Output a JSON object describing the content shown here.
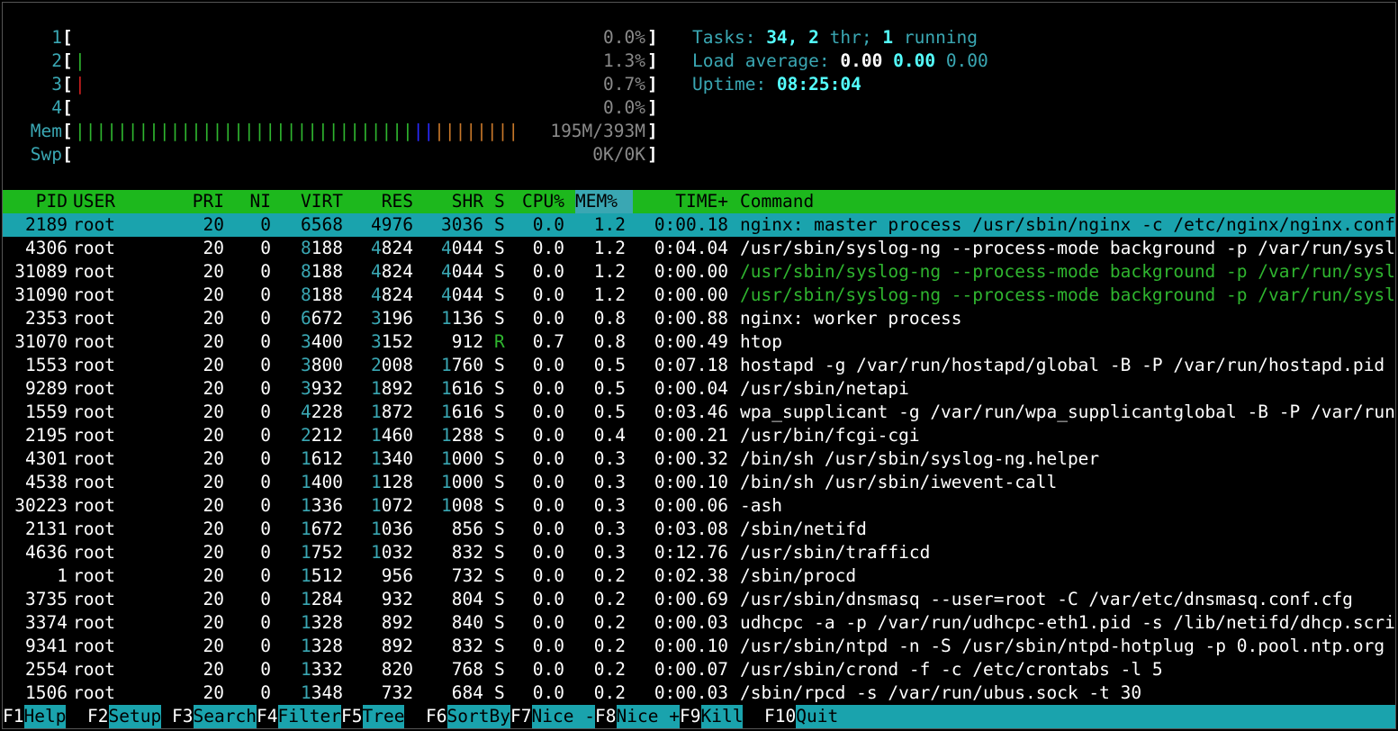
{
  "meters": [
    {
      "label": "1",
      "bars": [],
      "value": "0.0%"
    },
    {
      "label": "2",
      "bars": [
        {
          "color": "green",
          "count": 1
        }
      ],
      "value": "1.3%"
    },
    {
      "label": "3",
      "bars": [
        {
          "color": "red",
          "count": 1
        }
      ],
      "value": "0.7%"
    },
    {
      "label": "4",
      "bars": [],
      "value": "0.0%"
    },
    {
      "label": "Mem",
      "bars": [
        {
          "color": "green",
          "count": 32
        },
        {
          "color": "blue",
          "count": 2
        },
        {
          "color": "orange",
          "count": 8
        }
      ],
      "value": "195M/393M"
    },
    {
      "label": "Swp",
      "bars": [],
      "value": "0K/0K"
    }
  ],
  "summary": {
    "tasks_label": "Tasks: ",
    "tasks_count": "34",
    "tasks_sep": ", ",
    "threads": "2",
    "threads_label": " thr; ",
    "running": "1",
    "running_label": " running",
    "load_label": "Load average: ",
    "load1": "0.00",
    "load5": "0.00",
    "load15": "0.00",
    "uptime_label": "Uptime: ",
    "uptime": "08:25:04"
  },
  "columns": {
    "pid": "PID",
    "user": "USER",
    "pri": "PRI",
    "ni": "NI",
    "virt": "VIRT",
    "res": "RES",
    "shr": "SHR",
    "s": "S",
    "cpu": "CPU%",
    "mem": "MEM%",
    "time": "TIME+",
    "cmd": "Command"
  },
  "processes": [
    {
      "pid": "2189",
      "user": "root",
      "pri": "20",
      "ni": "0",
      "virt": "6568",
      "res": "4976",
      "shr": "3036",
      "s": "S",
      "cpu": "0.0",
      "mem": "1.2",
      "time": "0:00.18",
      "cmd": "nginx: master process /usr/sbin/nginx -c /etc/nginx/nginx.conf",
      "selected": true,
      "thread": false
    },
    {
      "pid": "4306",
      "user": "root",
      "pri": "20",
      "ni": "0",
      "virt": "8188",
      "res": "4824",
      "shr": "4044",
      "s": "S",
      "cpu": "0.0",
      "mem": "1.2",
      "time": "0:04.04",
      "cmd": "/usr/sbin/syslog-ng --process-mode background -p /var/run/syslog-ng.pid",
      "selected": false,
      "thread": false
    },
    {
      "pid": "31089",
      "user": "root",
      "pri": "20",
      "ni": "0",
      "virt": "8188",
      "res": "4824",
      "shr": "4044",
      "s": "S",
      "cpu": "0.0",
      "mem": "1.2",
      "time": "0:00.00",
      "cmd": "/usr/sbin/syslog-ng --process-mode background -p /var/run/syslog-ng.pid",
      "selected": false,
      "thread": true
    },
    {
      "pid": "31090",
      "user": "root",
      "pri": "20",
      "ni": "0",
      "virt": "8188",
      "res": "4824",
      "shr": "4044",
      "s": "S",
      "cpu": "0.0",
      "mem": "1.2",
      "time": "0:00.00",
      "cmd": "/usr/sbin/syslog-ng --process-mode background -p /var/run/syslog-ng.pid",
      "selected": false,
      "thread": true
    },
    {
      "pid": "2353",
      "user": "root",
      "pri": "20",
      "ni": "0",
      "virt": "6672",
      "res": "3196",
      "shr": "1136",
      "s": "S",
      "cpu": "0.0",
      "mem": "0.8",
      "time": "0:00.88",
      "cmd": "nginx: worker process",
      "selected": false,
      "thread": false
    },
    {
      "pid": "31070",
      "user": "root",
      "pri": "20",
      "ni": "0",
      "virt": "3400",
      "res": "3152",
      "shr": "912",
      "s": "R",
      "cpu": "0.7",
      "mem": "0.8",
      "time": "0:00.49",
      "cmd": "htop",
      "selected": false,
      "thread": false
    },
    {
      "pid": "1553",
      "user": "root",
      "pri": "20",
      "ni": "0",
      "virt": "3800",
      "res": "2008",
      "shr": "1760",
      "s": "S",
      "cpu": "0.0",
      "mem": "0.5",
      "time": "0:07.18",
      "cmd": "hostapd -g /var/run/hostapd/global -B -P /var/run/hostapd.pid",
      "selected": false,
      "thread": false
    },
    {
      "pid": "9289",
      "user": "root",
      "pri": "20",
      "ni": "0",
      "virt": "3932",
      "res": "1892",
      "shr": "1616",
      "s": "S",
      "cpu": "0.0",
      "mem": "0.5",
      "time": "0:00.04",
      "cmd": "/usr/sbin/netapi",
      "selected": false,
      "thread": false
    },
    {
      "pid": "1559",
      "user": "root",
      "pri": "20",
      "ni": "0",
      "virt": "4228",
      "res": "1872",
      "shr": "1616",
      "s": "S",
      "cpu": "0.0",
      "mem": "0.5",
      "time": "0:03.46",
      "cmd": "wpa_supplicant -g /var/run/wpa_supplicantglobal -B -P /var/run/wpa.pid",
      "selected": false,
      "thread": false
    },
    {
      "pid": "2195",
      "user": "root",
      "pri": "20",
      "ni": "0",
      "virt": "2212",
      "res": "1460",
      "shr": "1288",
      "s": "S",
      "cpu": "0.0",
      "mem": "0.4",
      "time": "0:00.21",
      "cmd": "/usr/bin/fcgi-cgi",
      "selected": false,
      "thread": false
    },
    {
      "pid": "4301",
      "user": "root",
      "pri": "20",
      "ni": "0",
      "virt": "1612",
      "res": "1340",
      "shr": "1000",
      "s": "S",
      "cpu": "0.0",
      "mem": "0.3",
      "time": "0:00.32",
      "cmd": "/bin/sh /usr/sbin/syslog-ng.helper",
      "selected": false,
      "thread": false
    },
    {
      "pid": "4538",
      "user": "root",
      "pri": "20",
      "ni": "0",
      "virt": "1400",
      "res": "1128",
      "shr": "1000",
      "s": "S",
      "cpu": "0.0",
      "mem": "0.3",
      "time": "0:00.10",
      "cmd": "/bin/sh /usr/sbin/iwevent-call",
      "selected": false,
      "thread": false
    },
    {
      "pid": "30223",
      "user": "root",
      "pri": "20",
      "ni": "0",
      "virt": "1336",
      "res": "1072",
      "shr": "1008",
      "s": "S",
      "cpu": "0.0",
      "mem": "0.3",
      "time": "0:00.06",
      "cmd": "-ash",
      "selected": false,
      "thread": false
    },
    {
      "pid": "2131",
      "user": "root",
      "pri": "20",
      "ni": "0",
      "virt": "1672",
      "res": "1036",
      "shr": "856",
      "s": "S",
      "cpu": "0.0",
      "mem": "0.3",
      "time": "0:03.08",
      "cmd": "/sbin/netifd",
      "selected": false,
      "thread": false
    },
    {
      "pid": "4636",
      "user": "root",
      "pri": "20",
      "ni": "0",
      "virt": "1752",
      "res": "1032",
      "shr": "832",
      "s": "S",
      "cpu": "0.0",
      "mem": "0.3",
      "time": "0:12.76",
      "cmd": "/usr/sbin/trafficd",
      "selected": false,
      "thread": false
    },
    {
      "pid": "1",
      "user": "root",
      "pri": "20",
      "ni": "0",
      "virt": "1512",
      "res": "956",
      "shr": "732",
      "s": "S",
      "cpu": "0.0",
      "mem": "0.2",
      "time": "0:02.38",
      "cmd": "/sbin/procd",
      "selected": false,
      "thread": false
    },
    {
      "pid": "3735",
      "user": "root",
      "pri": "20",
      "ni": "0",
      "virt": "1284",
      "res": "932",
      "shr": "804",
      "s": "S",
      "cpu": "0.0",
      "mem": "0.2",
      "time": "0:00.69",
      "cmd": "/usr/sbin/dnsmasq --user=root -C /var/etc/dnsmasq.conf.cfg",
      "selected": false,
      "thread": false
    },
    {
      "pid": "3374",
      "user": "root",
      "pri": "20",
      "ni": "0",
      "virt": "1328",
      "res": "892",
      "shr": "840",
      "s": "S",
      "cpu": "0.0",
      "mem": "0.2",
      "time": "0:00.03",
      "cmd": "udhcpc -a -p /var/run/udhcpc-eth1.pid -s /lib/netifd/dhcp.script",
      "selected": false,
      "thread": false
    },
    {
      "pid": "9341",
      "user": "root",
      "pri": "20",
      "ni": "0",
      "virt": "1328",
      "res": "892",
      "shr": "832",
      "s": "S",
      "cpu": "0.0",
      "mem": "0.2",
      "time": "0:00.10",
      "cmd": "/usr/sbin/ntpd -n -S /usr/sbin/ntpd-hotplug -p 0.pool.ntp.org",
      "selected": false,
      "thread": false
    },
    {
      "pid": "2554",
      "user": "root",
      "pri": "20",
      "ni": "0",
      "virt": "1332",
      "res": "820",
      "shr": "768",
      "s": "S",
      "cpu": "0.0",
      "mem": "0.2",
      "time": "0:00.07",
      "cmd": "/usr/sbin/crond -f -c /etc/crontabs -l 5",
      "selected": false,
      "thread": false
    },
    {
      "pid": "1506",
      "user": "root",
      "pri": "20",
      "ni": "0",
      "virt": "1348",
      "res": "732",
      "shr": "684",
      "s": "S",
      "cpu": "0.0",
      "mem": "0.2",
      "time": "0:00.03",
      "cmd": "/sbin/rpcd -s /var/run/ubus.sock -t 30",
      "selected": false,
      "thread": false
    }
  ],
  "footer": [
    {
      "key": "F1",
      "label": "Help  "
    },
    {
      "key": "F2",
      "label": "Setup "
    },
    {
      "key": "F3",
      "label": "Search"
    },
    {
      "key": "F4",
      "label": "Filter"
    },
    {
      "key": "F5",
      "label": "Tree  "
    },
    {
      "key": "F6",
      "label": "SortBy"
    },
    {
      "key": "F7",
      "label": "Nice -"
    },
    {
      "key": "F8",
      "label": "Nice +"
    },
    {
      "key": "F9",
      "label": "Kill  "
    },
    {
      "key": "F10",
      "label": "Quit"
    }
  ]
}
